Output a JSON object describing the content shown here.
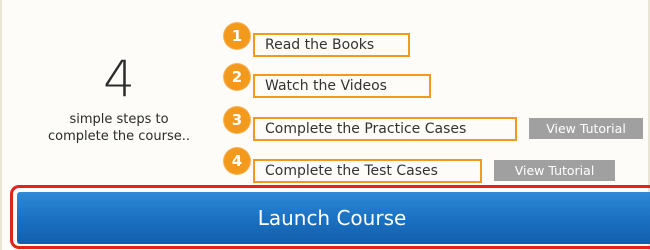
{
  "summary": {
    "count": "4",
    "tagline_line1": "simple steps to",
    "tagline_line2": "complete the course.."
  },
  "steps": [
    {
      "number": "1",
      "label": "Read the Books"
    },
    {
      "number": "2",
      "label": "Watch the Videos"
    },
    {
      "number": "3",
      "label": "Complete the Practice Cases",
      "tutorial_label": "View Tutorial"
    },
    {
      "number": "4",
      "label": "Complete the Test Cases",
      "tutorial_label": "View Tutorial"
    }
  ],
  "launch": {
    "label": "Launch Course"
  },
  "colors": {
    "step_accent": "#f39a1d",
    "tutorial_button": "#a0a0a0",
    "launch_button": "#1a6fc0",
    "highlight_outline": "#e3231b"
  }
}
